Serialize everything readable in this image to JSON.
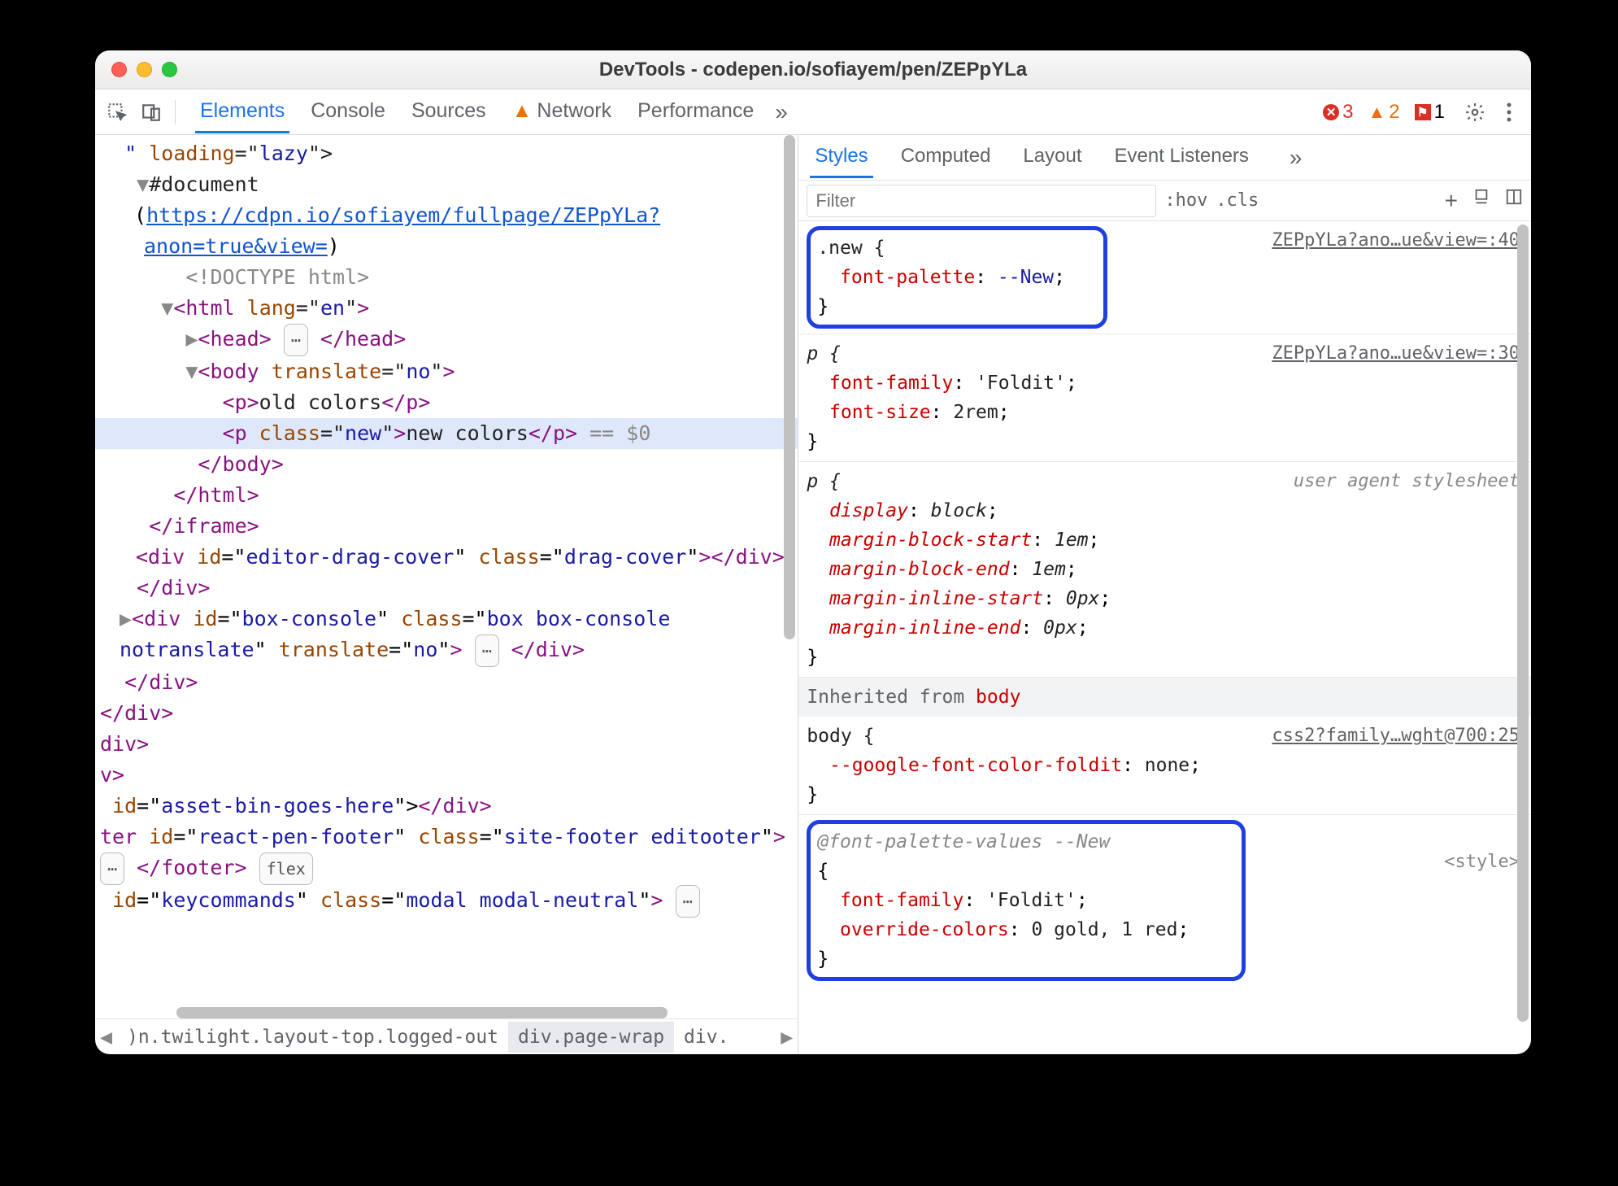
{
  "title": "DevTools - codepen.io/sofiayem/pen/ZEPpYLa",
  "mainTabs": {
    "elements": "Elements",
    "console": "Console",
    "sources": "Sources",
    "network": "Network",
    "performance": "Performance"
  },
  "counts": {
    "errors": "3",
    "warnings": "2",
    "issues": "1"
  },
  "dom": {
    "l1": "\" loading=\"lazy\">",
    "l2a": "▼",
    "l2b": "#document",
    "l3a": "(",
    "l3b": "https://cdpn.io/sofiayem/fullpage/ZEPpYLa?anon=true&view=",
    "l3c": ")",
    "l4": "<!DOCTYPE html>",
    "l5a": "▼",
    "l5b": "<html ",
    "l5c": "lang",
    "l5d": "=\"",
    "l5e": "en",
    "l5f": "\">",
    "l6a": "▶",
    "l6b": "<head>",
    "l6c": "…",
    "l6d": "</head>",
    "l7a": "▼",
    "l7b": "<body ",
    "l7c": "translate",
    "l7d": "=\"",
    "l7e": "no",
    "l7f": "\">",
    "l8a": "<p>",
    "l8b": "old colors",
    "l8c": "</p>",
    "l9a": "<p ",
    "l9b": "class",
    "l9c": "=\"",
    "l9d": "new",
    "l9e": "\">",
    "l9f": "new colors",
    "l9g": "</p>",
    "l9h": " == $0",
    "l10": "</body>",
    "l11": "</html>",
    "l12": "</iframe>",
    "l13a": "<div ",
    "l13b": "id",
    "l13c": "=\"",
    "l13d": "editor-drag-cover",
    "l13e": "\" ",
    "l13f": "class",
    "l13g": "=\"",
    "l13h": "drag-cover",
    "l13i": "\">",
    "l13j": "</div>",
    "l14": "</div>",
    "l15a": "▶",
    "l15b": "<div ",
    "l15c": "id",
    "l15d": "=\"",
    "l15e": "box-console",
    "l15f": "\" ",
    "l15g": "class",
    "l15h": "=\"",
    "l15i": "box box-console notranslate",
    "l15j": "\" ",
    "l15k": "translate",
    "l15l": "=\"",
    "l15m": "no",
    "l15n": "\">",
    "l15o": "…",
    "l15p": "</div>",
    "l16": "</div>",
    "l17": "</div>",
    "l18": "div>",
    "l19": "v>",
    "l20a": " id=\"",
    "l20b": "asset-bin-goes-here",
    "l20c": "\"></div>",
    "l21a": "ter ",
    "l21b": "id",
    "l21c": "=\"",
    "l21d": "react-pen-footer",
    "l21e": "\" ",
    "l21f": "class",
    "l21g": "=\"",
    "l21h": "site-footer editooter",
    "l21i": "\">",
    "l21j": "…",
    "l21k": "</footer>",
    "l21l": "flex",
    "l22a": " id=\"",
    "l22b": "keycommands",
    "l22c": "\" ",
    "l22d": "class",
    "l22e": "=\"",
    "l22f": "modal modal-neutral",
    "l22g": "\">",
    "l22h": "…"
  },
  "crumbs": {
    "c1": ")n.twilight.layout-top.logged-out",
    "c2": "div.page-wrap",
    "c3": "div."
  },
  "subtabs": {
    "styles": "Styles",
    "computed": "Computed",
    "layout": "Layout",
    "events": "Event Listeners"
  },
  "filter": {
    "placeholder": "Filter",
    "hov": ":hov",
    "cls": ".cls"
  },
  "rules": {
    "r1": {
      "sel": ".new {",
      "p1": "font-palette",
      "v1": "--New",
      "close": "}",
      "src": "ZEPpYLa?ano…ue&view=:40"
    },
    "r2": {
      "sel": "p {",
      "p1": "font-family",
      "v1": "'Foldit'",
      "p2": "font-size",
      "v2": "2rem",
      "close": "}",
      "src": "ZEPpYLa?ano…ue&view=:30"
    },
    "r3": {
      "sel": "p {",
      "p1": "display",
      "v1": "block",
      "p2": "margin-block-start",
      "v2": "1em",
      "p3": "margin-block-end",
      "v3": "1em",
      "p4": "margin-inline-start",
      "v4": "0px",
      "p5": "margin-inline-end",
      "v5": "0px",
      "close": "}",
      "src": "user agent stylesheet"
    },
    "inherit": "Inherited from ",
    "inheritBody": "body",
    "r4": {
      "sel": "body {",
      "p1": "--google-font-color-foldit",
      "v1": "none",
      "close": "}",
      "src": "css2?family…wght@700:25"
    },
    "r5": {
      "hd": "@font-palette-values --New",
      "open": "{",
      "p1": "font-family",
      "v1": "'Foldit'",
      "p2": "override-colors",
      "v2": "0 gold, 1 red",
      "close": "}",
      "src": "<style>"
    }
  }
}
